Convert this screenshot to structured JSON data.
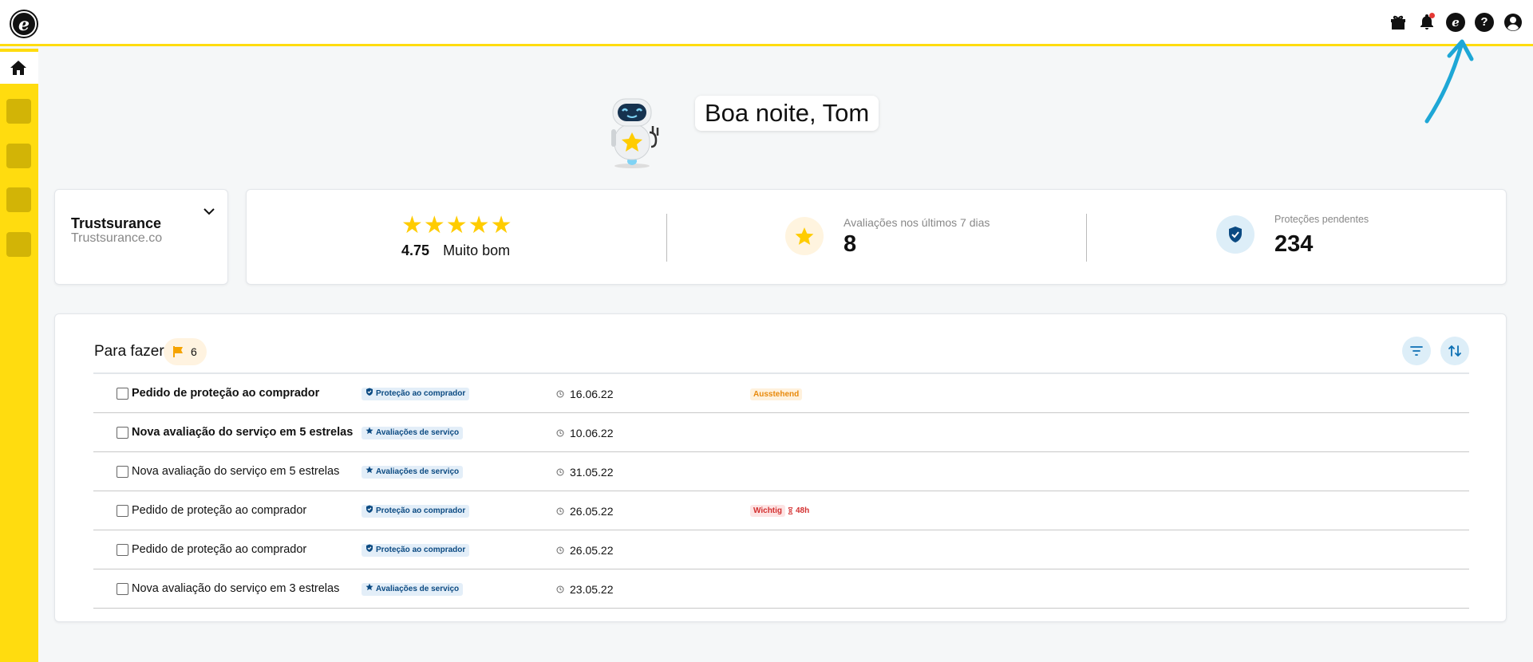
{
  "app": {
    "logo_letter": "e",
    "accent_color": "#ffdc0f",
    "icons": [
      "gift-icon",
      "bell-icon",
      "etrusted-icon",
      "help-icon",
      "account-icon"
    ],
    "notification_dot_color": "#e53935",
    "help_glyph": "?",
    "e_glyph": "e"
  },
  "sidebar": {
    "items": [
      "home-icon",
      "nav-item",
      "nav-item",
      "nav-item",
      "nav-item"
    ]
  },
  "greeting": {
    "text": "Boa noite, Tom"
  },
  "company": {
    "name": "Trustsurance",
    "domain": "Trustsurance.co"
  },
  "rating": {
    "stars": "★★★★★",
    "value": "4.75",
    "label": "Muito bom",
    "star_count": 5
  },
  "reviews_7d": {
    "label": "Avaliações nos últimos 7 dias",
    "value": "8"
  },
  "pending_protections": {
    "label": "Proteções pendentes",
    "value": "234"
  },
  "todo": {
    "title": "Para fazer",
    "count": "6",
    "rows": [
      {
        "title": "Pedido de proteção ao comprador",
        "bold": true,
        "tag": "Proteção ao comprador",
        "tag_icon": "shield-check-icon",
        "date": "16.06.22",
        "status": "Ausstehend",
        "status_type": "pending",
        "deadline": ""
      },
      {
        "title": "Nova avaliação do serviço em 5 estrelas",
        "bold": true,
        "tag": "Avaliações de serviço",
        "tag_icon": "star-icon",
        "date": "10.06.22",
        "status": "",
        "status_type": "",
        "deadline": ""
      },
      {
        "title": "Nova avaliação do serviço em 5 estrelas",
        "bold": false,
        "tag": "Avaliações de serviço",
        "tag_icon": "star-icon",
        "date": "31.05.22",
        "status": "",
        "status_type": "",
        "deadline": ""
      },
      {
        "title": "Pedido de proteção ao comprador",
        "bold": false,
        "tag": "Proteção ao comprador",
        "tag_icon": "shield-check-icon",
        "date": "26.05.22",
        "status": "Wichtig",
        "status_type": "important",
        "deadline": "48h"
      },
      {
        "title": "Pedido de proteção ao comprador",
        "bold": false,
        "tag": "Proteção ao comprador",
        "tag_icon": "shield-check-icon",
        "date": "26.05.22",
        "status": "",
        "status_type": "",
        "deadline": ""
      },
      {
        "title": "Nova avaliação do serviço em 3 estrelas",
        "bold": false,
        "tag": "Avaliações de serviço",
        "tag_icon": "star-icon",
        "date": "23.05.22",
        "status": "",
        "status_type": "",
        "deadline": ""
      }
    ]
  }
}
